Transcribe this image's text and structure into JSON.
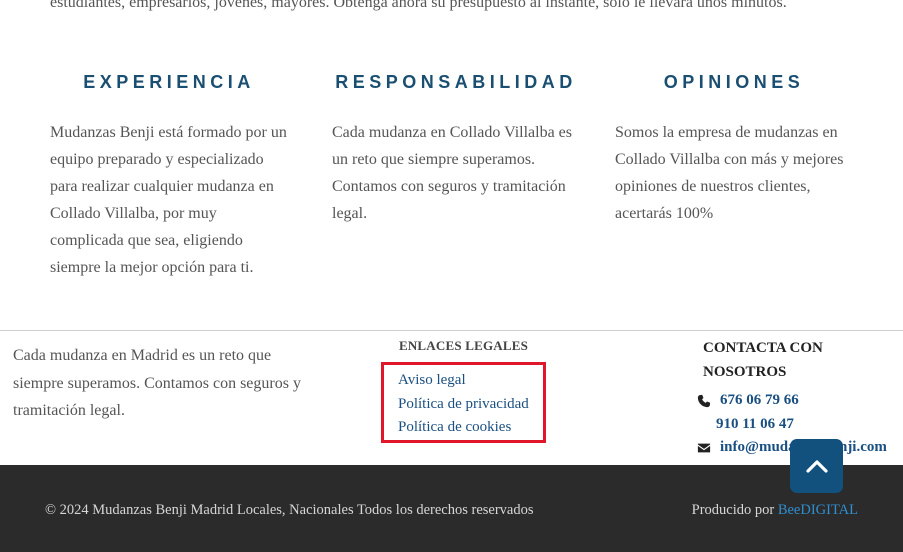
{
  "intro": {
    "text": "estudiantes, empresarios, jóvenes, mayores. Obtenga ahora su presupuesto al instante, sólo le llevará unos minutos."
  },
  "features": [
    {
      "title": "EXPERIENCIA",
      "text": "Mudanzas Benji está formado por un equipo preparado y especializado para realizar cualquier mudanza en Collado Villalba, por muy complicada que sea, eligiendo siempre la mejor opción para ti."
    },
    {
      "title": "RESPONSABILIDAD",
      "text": "Cada mudanza en Collado Villalba es un reto que siempre superamos. Contamos con seguros y tramitación legal."
    },
    {
      "title": "OPINIONES",
      "text": "Somos la empresa de mudanzas en Collado Villalba con más y mejores opiniones de nuestros clientes, acertarás 100%"
    }
  ],
  "footer": {
    "about": "Cada mudanza en Madrid es un reto que siempre superamos. Contamos con seguros y tramitación legal.",
    "legal": {
      "heading": "ENLACES LEGALES",
      "links": [
        "Aviso legal",
        "Política de privacidad",
        "Política de cookies"
      ]
    },
    "contact": {
      "heading": "CONTACTA CON NOSOTROS",
      "phone1": "676 06 79 66",
      "phone2": "910 11 06 47",
      "email": "info@mudanzasbenji.com"
    }
  },
  "bottom_bar": {
    "copyright": "© 2024 Mudanzas Benji Madrid Locales, Nacionales Todos los derechos reservados",
    "produced_by_label": "Producido por ",
    "produced_by_link": "BeeDIGITAL"
  },
  "icons": {
    "phone": "phone-icon",
    "email": "envelope-icon",
    "scroll_top": "chevron-up-icon"
  },
  "colors": {
    "heading_blue": "#1b4f72",
    "link_blue": "#1a4f82",
    "highlight_red": "#e0162b",
    "footer_dark": "#2b2b2b",
    "scroll_button": "#12507e",
    "brand_link": "#2f8fd0"
  }
}
